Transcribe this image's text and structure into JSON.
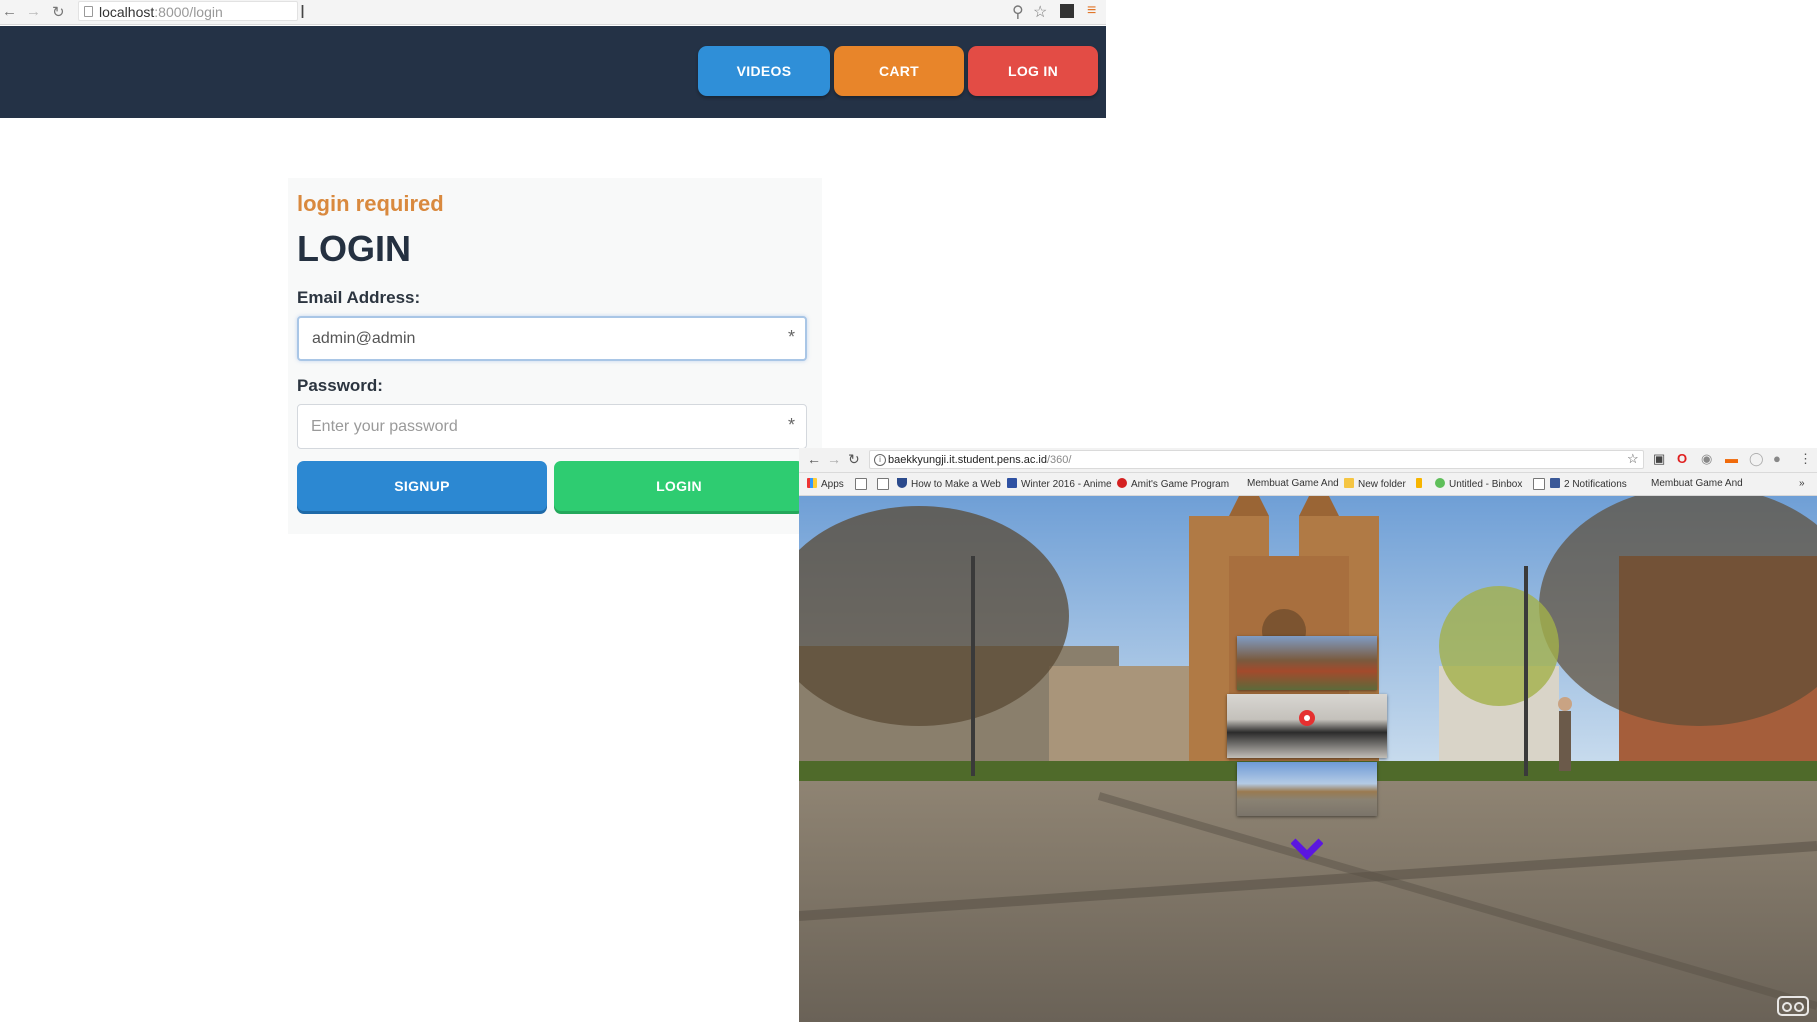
{
  "login_window": {
    "browser": {
      "url_host": "localhost",
      "url_path": ":8000/login"
    },
    "navbar": {
      "videos_label": "VIDEOS",
      "cart_label": "CART",
      "login_label": "LOG IN"
    },
    "form": {
      "notice": "login required",
      "title": "LOGIN",
      "email_label": "Email Address:",
      "email_value": "admin@admin",
      "password_label": "Password:",
      "password_placeholder": "Enter your password",
      "required_marker": "*",
      "signup_label": "SIGNUP",
      "login_label": "LOGIN"
    },
    "colors": {
      "navbar": "#243246",
      "videos": "#2f8fd8",
      "cart": "#e8852a",
      "login_nav": "#e34c45",
      "signup": "#2c88d2",
      "login_btn": "#2ecc71",
      "notice": "#d9893e"
    }
  },
  "viewer_window": {
    "browser": {
      "url_host": "baekkyungji.it.student.pens.ac.id",
      "url_path": "/360/"
    },
    "bookmarks": [
      {
        "label": "Apps",
        "icon": "apps-grid-icon"
      },
      {
        "label": "",
        "icon": "page-icon"
      },
      {
        "label": "",
        "icon": "page-icon"
      },
      {
        "label": "How to Make a Web",
        "icon": "shield-icon"
      },
      {
        "label": "Winter 2016 - Anime",
        "icon": "mal-icon"
      },
      {
        "label": "Amit's Game Program",
        "icon": "star-badge-icon"
      },
      {
        "label": "Membuat Game And",
        "icon": "page-icon"
      },
      {
        "label": "New folder",
        "icon": "folder-icon"
      },
      {
        "label": "",
        "icon": "bookmark-flag-icon"
      },
      {
        "label": "Untitled - Binbox",
        "icon": "binbox-icon"
      },
      {
        "label": "2 Notifications",
        "icon": "facebook-icon"
      },
      {
        "label": "Membuat Game And",
        "icon": "page-icon"
      }
    ],
    "more_bookmarks": "»",
    "panorama": {
      "scene": "city square with gothic church",
      "thumbnails": [
        "autumn-garden-thumbnail",
        "hall-crowd-thumbnail",
        "square-church-thumbnail"
      ],
      "down_arrow_color": "#5b16e0",
      "hotspot_color": "#e53030"
    }
  }
}
